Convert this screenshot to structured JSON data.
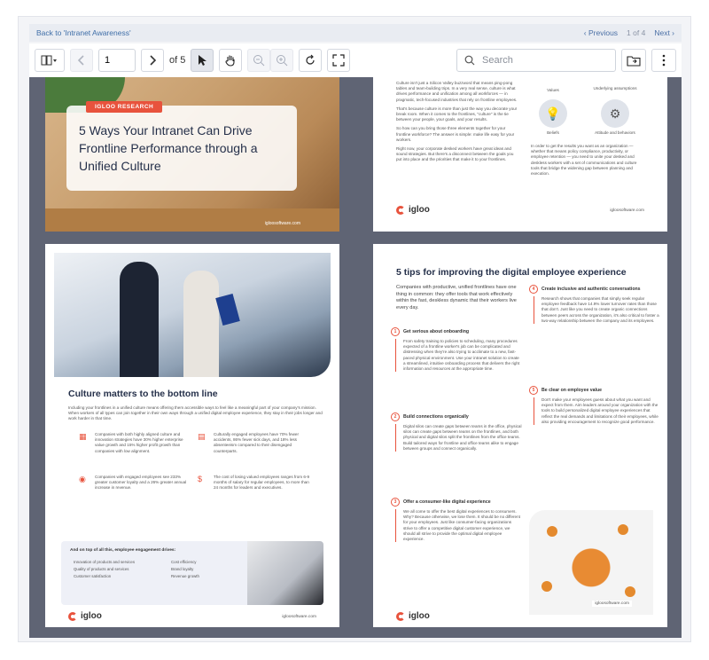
{
  "nav": {
    "back_label": "Back to 'Intranet Awareness'",
    "prev_label": "‹ Previous",
    "position": "1 of 4",
    "next_label": "Next ›"
  },
  "toolbar": {
    "page_value": "1",
    "of_pages": "of 5",
    "search_placeholder": "Search"
  },
  "icons": {
    "layout": "layout-grid-icon",
    "prev": "chevron-left-icon",
    "next": "chevron-right-icon",
    "select": "cursor-icon",
    "pan": "hand-icon",
    "zoom_out": "zoom-out-icon",
    "zoom_in": "zoom-in-icon",
    "rotate": "rotate-icon",
    "fullscreen": "fullscreen-icon",
    "search": "search-icon",
    "folder": "folder-icon",
    "more": "more-vertical-icon"
  },
  "page1": {
    "badge": "IGLOO RESEARCH",
    "title": "5 Ways Your Intranet Can Drive Frontline Performance through a Unified Culture",
    "url": "igloosoftware.com"
  },
  "page2": {
    "para1": "Culture isn't just a Silicon Valley buzzword that means ping-pong tables and team-building trips. In a very real sense, culture is what drives performance and unification among all workforces — in pragmatic, tech-focused industries that rely on frontline employees.",
    "para2": "That's because culture is more than just the way you decorate your break room. When it comes to the frontlines, \"culture\" is the tie between your people, your goals, and your results.",
    "para3": "So how can you bring those three elements together for your frontline workforce? The answer is simple: make life easy for your workers.",
    "para4": "Right now, your corporate desked workers have great ideas and sound strategies. But there's a disconnect between the goals you put into place and the priorities that make it to your frontlines.",
    "labels": [
      "Values",
      "Underlying assumptions",
      "Beliefs",
      "Attitude and behaviors"
    ],
    "closing": "In order to get the results you want as an organization — whether that means policy compliance, productivity, or employee retention — you need to unite your desked and deskless workers with a set of communications and culture tools that bridge the widening gap between planning and execution.",
    "brand": "igloo",
    "url": "igloosoftware.com"
  },
  "page3": {
    "heading": "Culture matters to the bottom line",
    "intro": "Including your frontlines in a unified culture means offering them accessible ways to feel like a meaningful part of your company's mission. When workers of all types can join together in their own ways through a unified digital employee experience, they stay in their jobs longer and work harder in that time.",
    "stats": [
      "Companies with both highly aligned culture and innovation strategies have 30% higher enterprise value growth and 15% higher profit growth than companies with low alignment.",
      "Culturally engaged employees have 70% fewer accidents, 86% fewer sick days, and 18% less absenteeism compared to their disengaged counterparts.",
      "Companies with engaged employees see 233% greater customer loyalty and a 26% greater annual increase in revenue.",
      "The cost of losing valued employees ranges from 6-9 months of salary for regular employees, to more than 24 months for leaders and executives."
    ],
    "box_title": "And on top of all this, employee engagement drives:",
    "drives_col1": [
      "Innovation of products and services",
      "Quality of products and services",
      "Customer satisfaction"
    ],
    "drives_col2": [
      "Cost efficiency",
      "Brand loyalty",
      "Revenue growth"
    ],
    "brand": "igloo",
    "url": "igloosoftware.com"
  },
  "page4": {
    "heading": "5 tips for improving the digital employee experience",
    "lead": "Companies with productive, unified frontlines have one thing in common: they offer tools that work effectively within the fast, deskless dynamic that their workers live every day.",
    "tips": [
      {
        "n": "1",
        "title": "Get serious about onboarding",
        "body": "From safety training to policies to scheduling, many procedures expected of a frontline worker's job can be complicated and distressing when they're also trying to acclimate to a new, fast-paced physical environment. Use your intranet solution to create a streamlined, intuitive onboarding process that delivers the right information and resources at the appropriate time."
      },
      {
        "n": "2",
        "title": "Build connections organically",
        "body": "Digital silos can create gaps between teams in the office, physical silos can create gaps between teams on the frontlines, and both physical and digital silos split the frontlines from the office teams. Build tailored ways for frontline and office teams alike to engage between groups and connect organically."
      },
      {
        "n": "3",
        "title": "Offer a consumer-like digital experience",
        "body": "We all come to offer the best digital experiences to consumers. Why? Because otherwise, we lose them. It should be no different for your employees. Just like consumer-facing organizations strive to offer a competitive digital customer experience, we should all strive to provide the optimal digital employee experience."
      },
      {
        "n": "4",
        "title": "Create inclusive and authentic conversations",
        "body": "Research shows that companies that simply seek regular employee feedback have 14.9% lower turnover rates than those that don't. Just like you need to create organic connections between peers across the organization, it's also critical to foster a two-way relationship between the company and its employees."
      },
      {
        "n": "5",
        "title": "Be clear on employee value",
        "body": "Don't make your employees guess about what you want and expect from them. Aim leaders around your organization with the tools to build personalized digital employee experiences that reflect the real demands and limitations of their employees, while also providing encouragement to recognize good performance."
      }
    ],
    "brand": "igloo",
    "url": "igloosoftware.com"
  }
}
